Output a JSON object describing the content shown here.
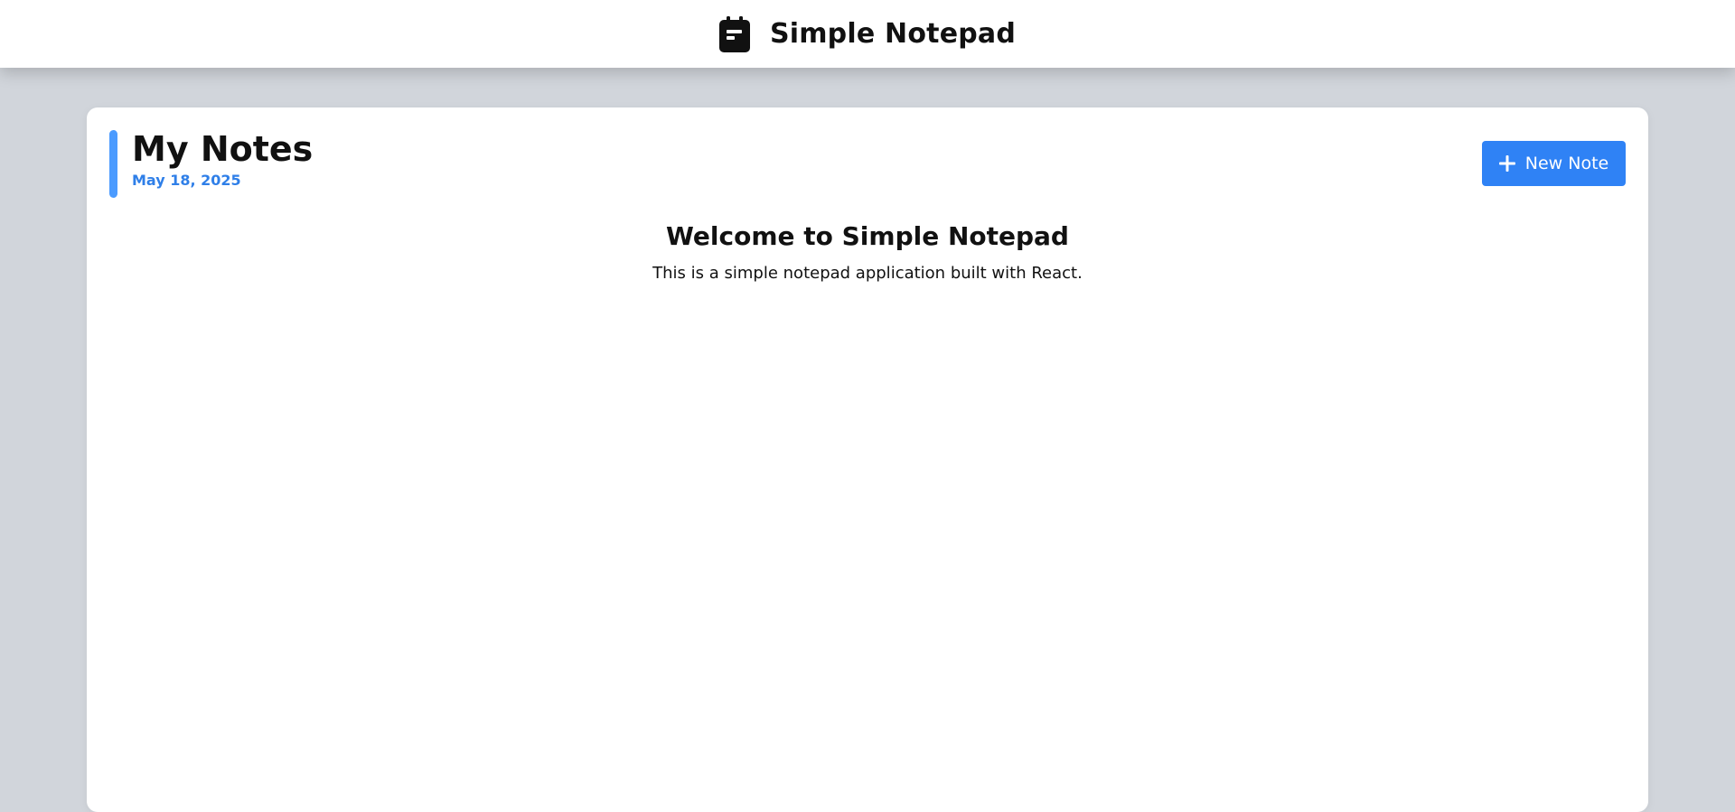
{
  "app": {
    "title": "Simple Notepad",
    "icon": "notepad-icon"
  },
  "header": {
    "title": "My Notes",
    "date": "May 18, 2025"
  },
  "toolbar": {
    "new_note_label": "New Note",
    "new_note_icon": "plus-icon"
  },
  "welcome": {
    "title": "Welcome to Simple Notepad",
    "text": "This is a simple notepad application built with React."
  },
  "colors": {
    "accent": "#4b9bff",
    "button": "#2f82f5",
    "date": "#2f7fe8",
    "background": "#d1d5db"
  }
}
